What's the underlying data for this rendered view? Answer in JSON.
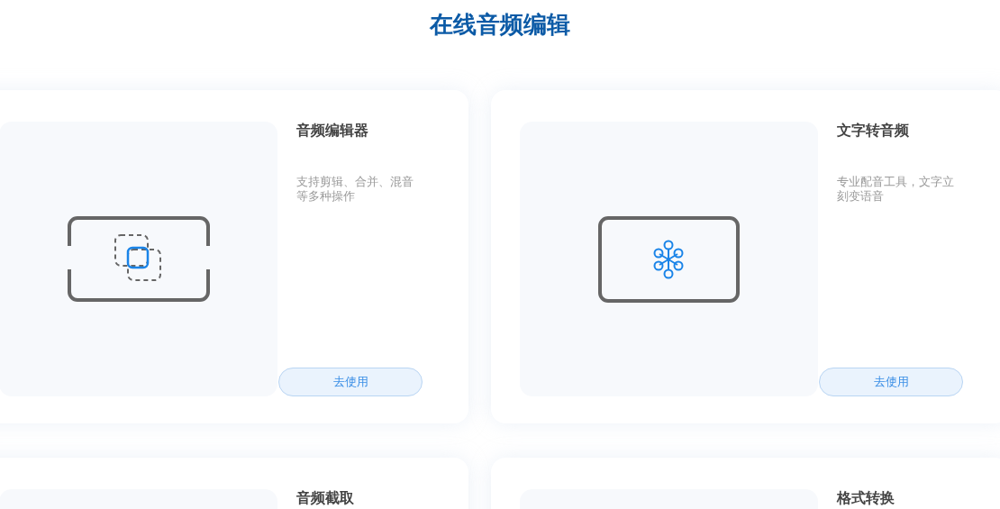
{
  "title": "在线音频编辑",
  "tools": [
    {
      "name": "音频编辑器",
      "description": "支持剪辑、合并、混音等多种操作",
      "button": "去使用",
      "kind": "editor"
    },
    {
      "name": "文字转音频",
      "description": "专业配音工具，文字立刻变语音",
      "button": "去使用",
      "kind": "tts"
    },
    {
      "name": "音频截取"
    },
    {
      "name": "格式转换"
    }
  ]
}
